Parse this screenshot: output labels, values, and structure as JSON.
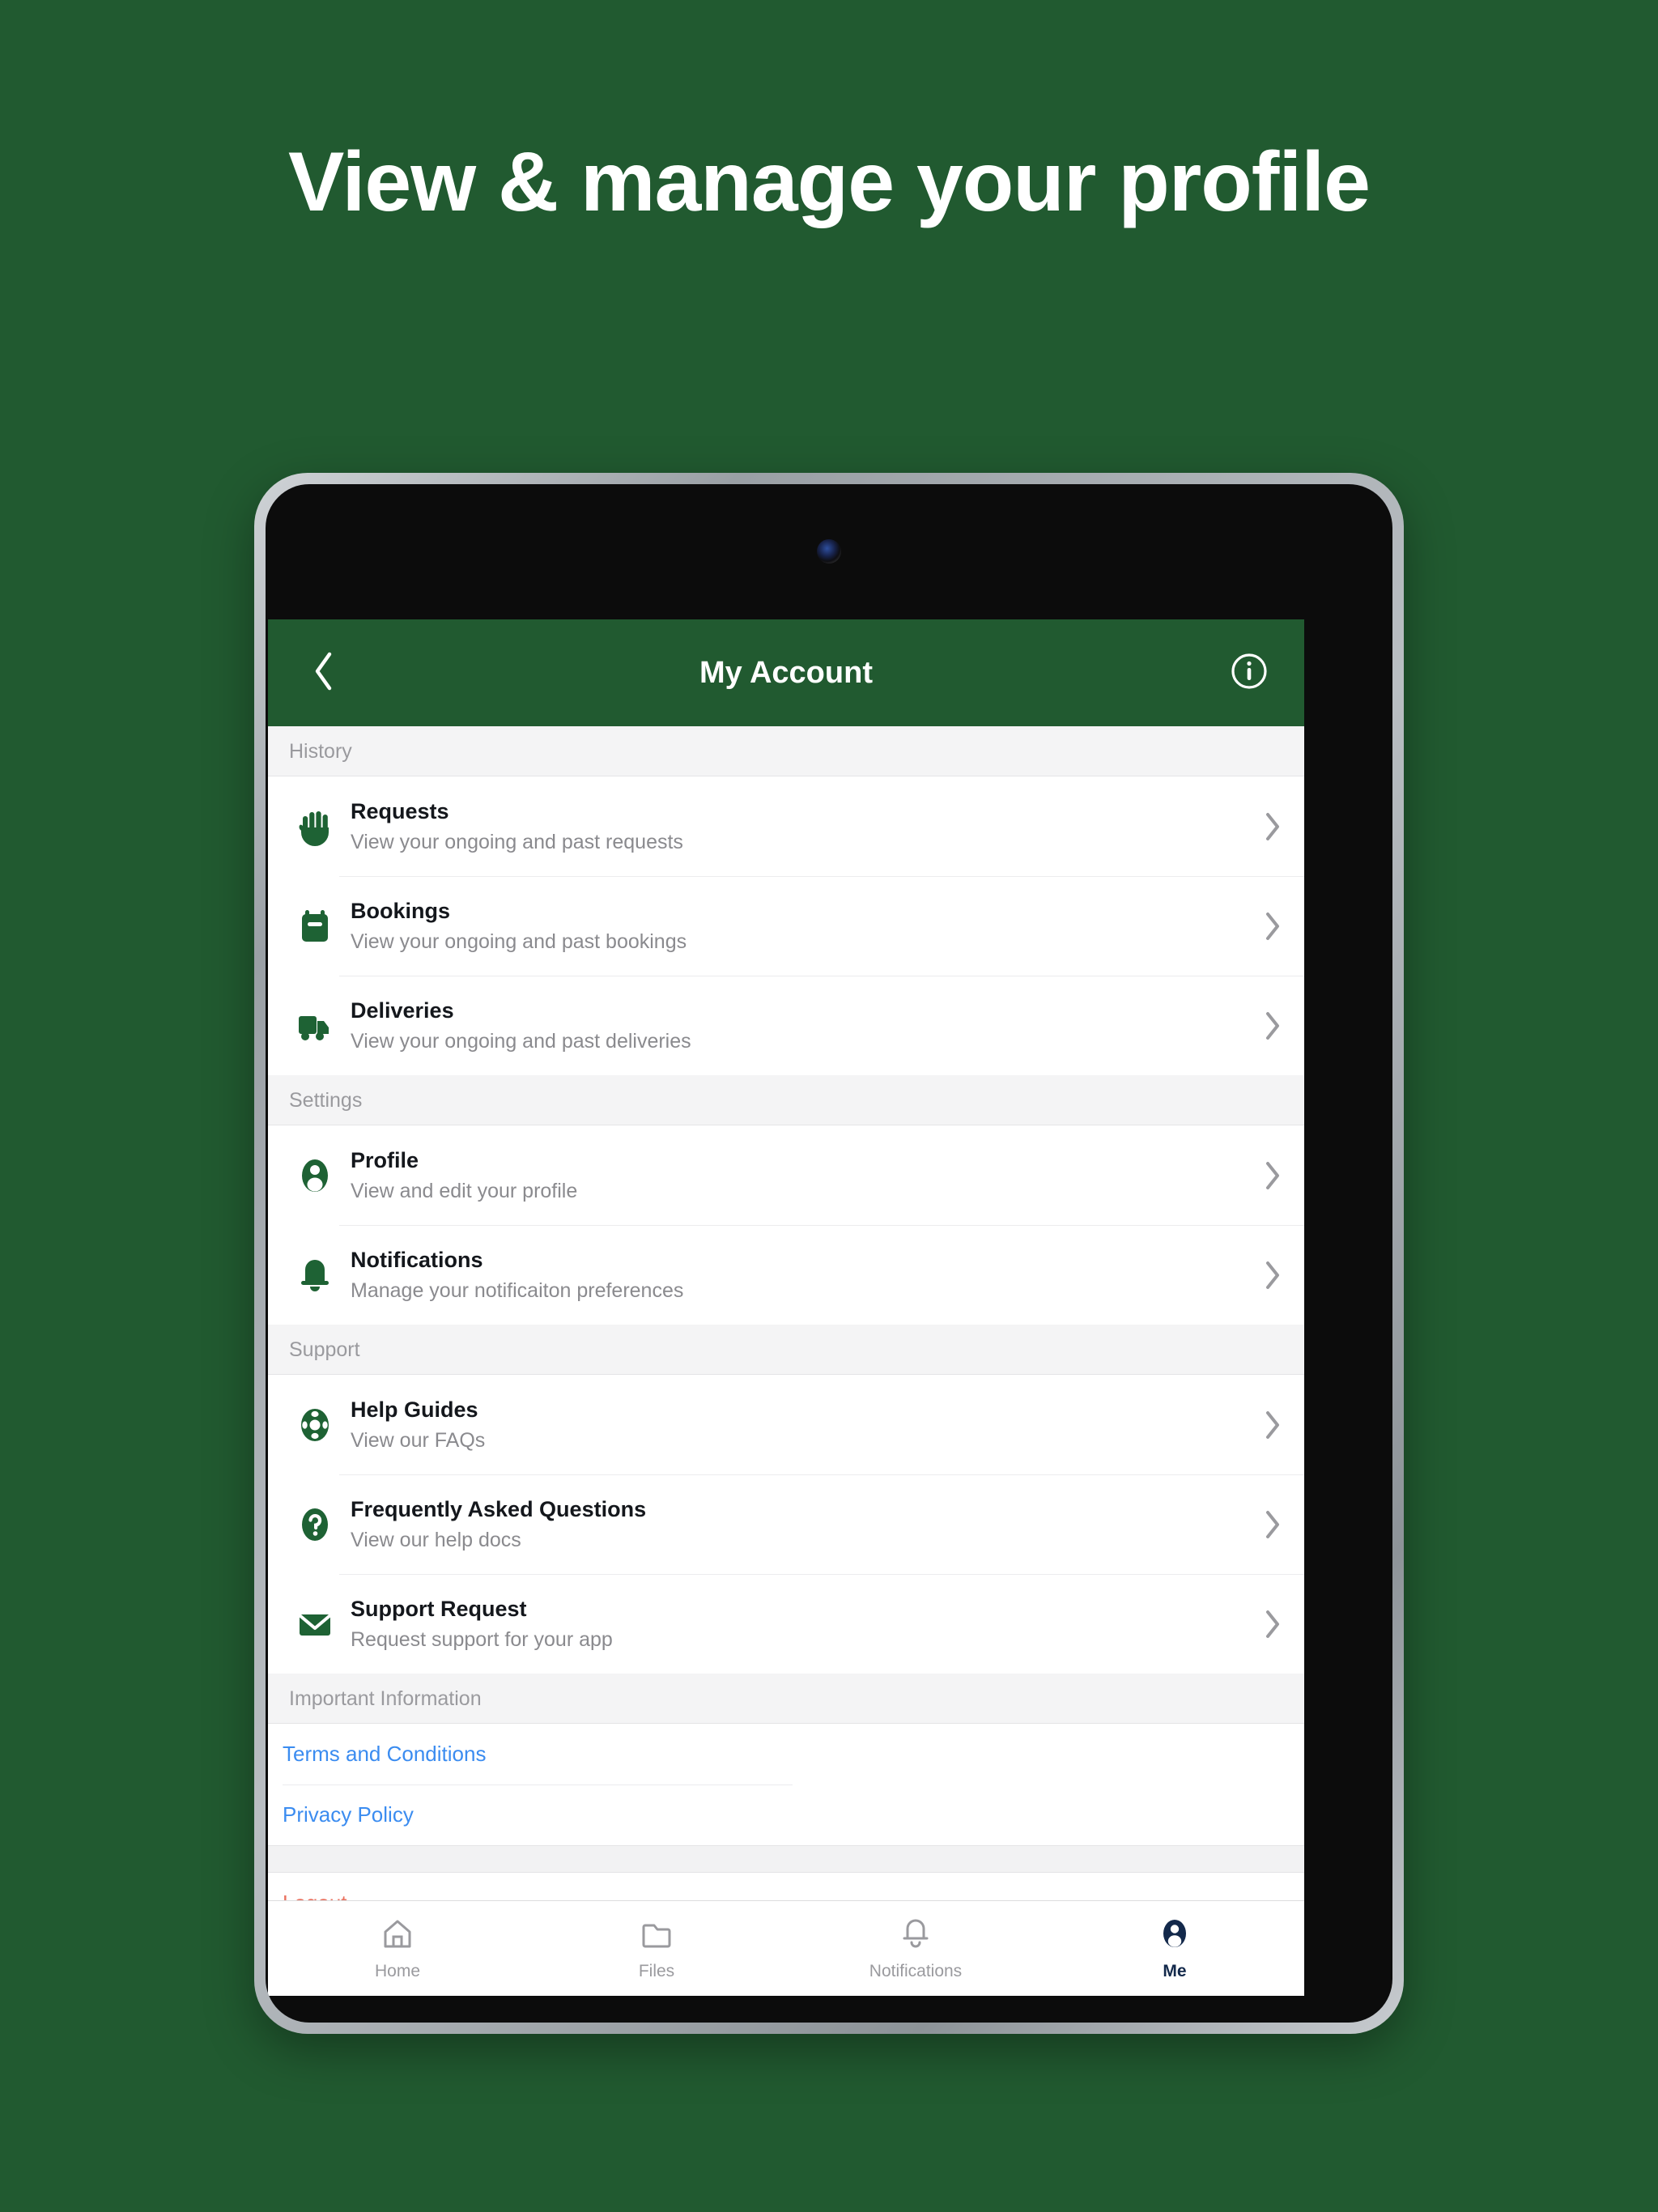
{
  "headline": "View & manage your profile",
  "colors": {
    "background_green": "#215A30",
    "header_green": "#215A30",
    "icon_green": "#1E6234",
    "link_blue": "#3b8cf0",
    "logout_red": "#e9715f",
    "active_tab_navy": "#13294B"
  },
  "app": {
    "header": {
      "title": "My Account",
      "back_icon": "chevron-left-icon",
      "info_icon": "info-circle-icon"
    },
    "sections": [
      {
        "title": "History",
        "rows": [
          {
            "icon": "hand-icon",
            "title": "Requests",
            "subtitle": "View your ongoing and past requests"
          },
          {
            "icon": "booking-icon",
            "title": "Bookings",
            "subtitle": "View your ongoing and past bookings"
          },
          {
            "icon": "truck-icon",
            "title": "Deliveries",
            "subtitle": "View your ongoing and past deliveries"
          }
        ]
      },
      {
        "title": "Settings",
        "rows": [
          {
            "icon": "person-icon",
            "title": "Profile",
            "subtitle": "View and edit your profile"
          },
          {
            "icon": "bell-icon",
            "title": "Notifications",
            "subtitle": "Manage your notificaiton preferences"
          }
        ]
      },
      {
        "title": "Support",
        "rows": [
          {
            "icon": "lifebuoy-icon",
            "title": "Help Guides",
            "subtitle": "View our FAQs"
          },
          {
            "icon": "question-mark-icon",
            "title": "Frequently Asked Questions",
            "subtitle": "View our help docs"
          },
          {
            "icon": "envelope-icon",
            "title": "Support Request",
            "subtitle": "Request support for your app"
          }
        ]
      }
    ],
    "important_information": {
      "title": "Important Information",
      "links": [
        {
          "label": "Terms and Conditions"
        },
        {
          "label": "Privacy Policy"
        }
      ]
    },
    "logout": {
      "label": "Logout"
    },
    "tabbar": [
      {
        "icon": "home-icon",
        "label": "Home",
        "active": false
      },
      {
        "icon": "folder-icon",
        "label": "Files",
        "active": false
      },
      {
        "icon": "bell-outline-icon",
        "label": "Notifications",
        "active": false
      },
      {
        "icon": "person-filled-icon",
        "label": "Me",
        "active": true
      }
    ]
  }
}
